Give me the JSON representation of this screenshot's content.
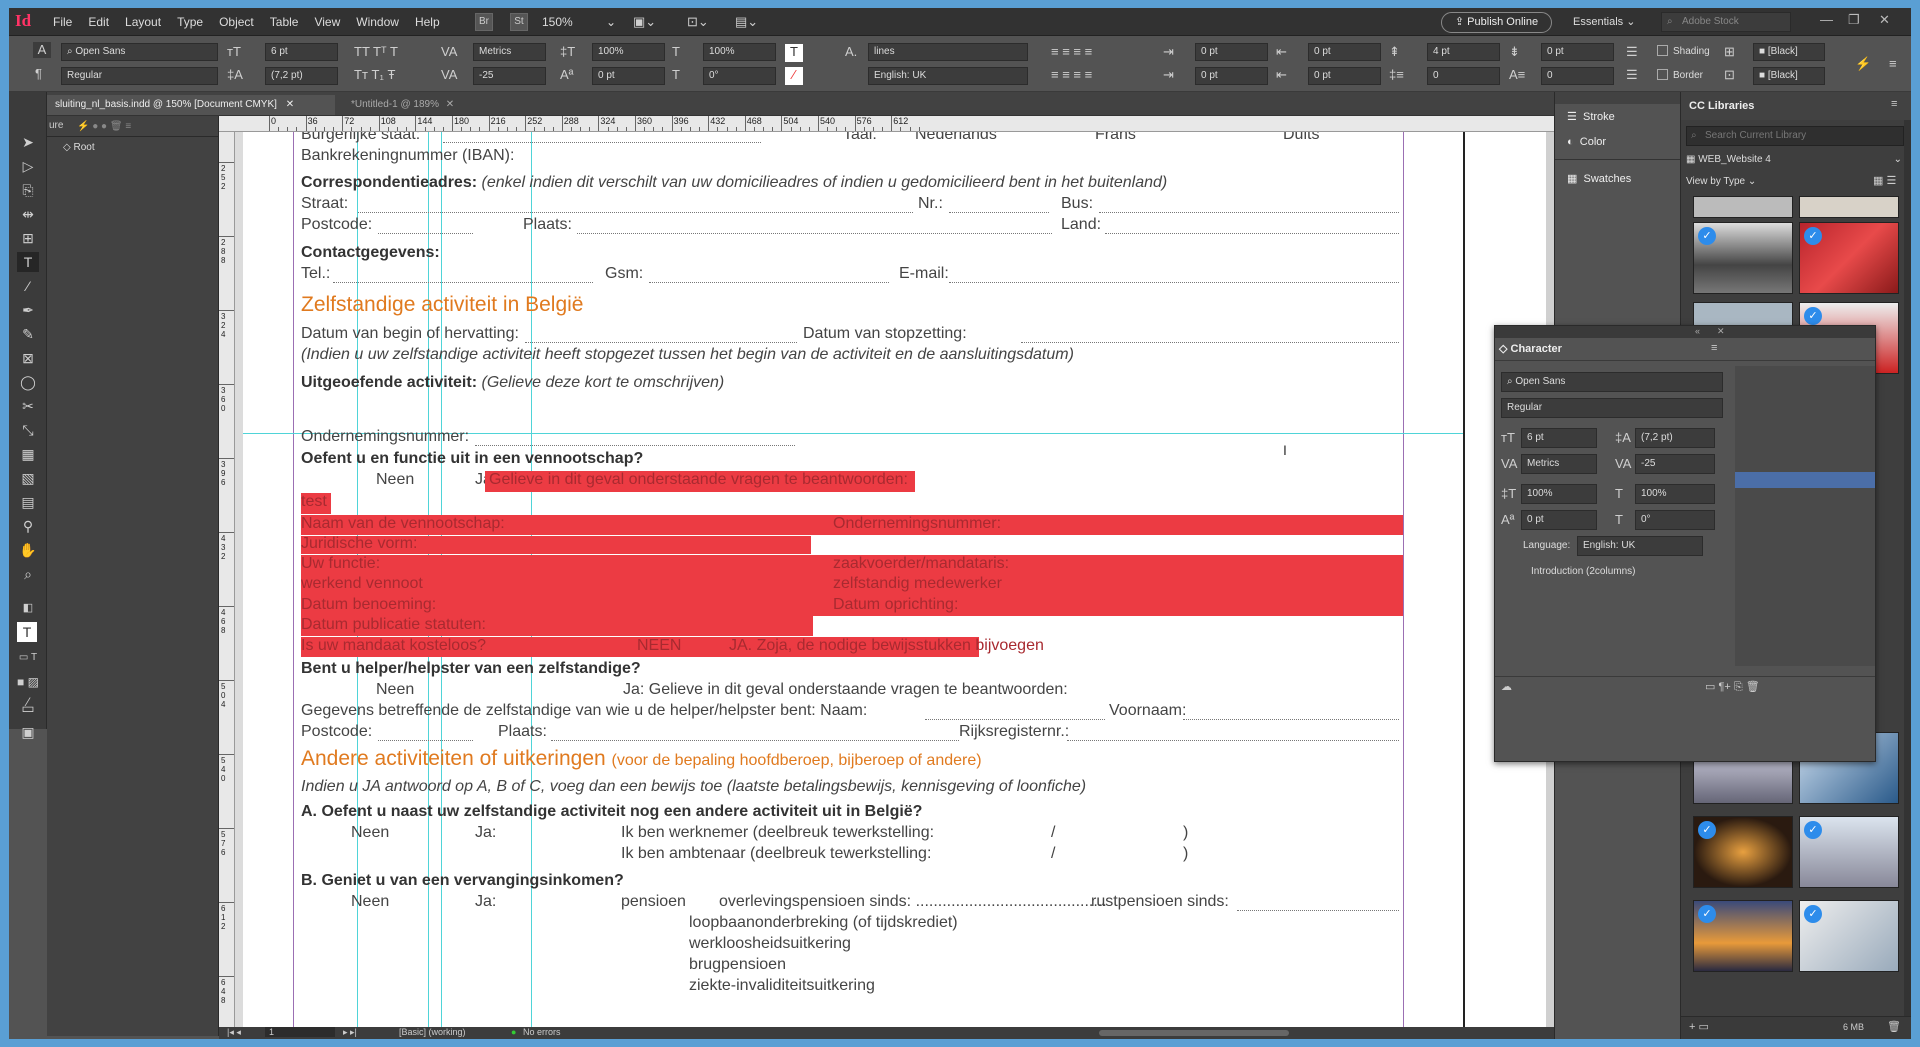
{
  "menubar": {
    "logo": "Id",
    "items": [
      "File",
      "Edit",
      "Layout",
      "Type",
      "Object",
      "Table",
      "View",
      "Window",
      "Help"
    ],
    "bridge": "Br",
    "stock_btn": "St",
    "zoom": "150%",
    "publish": "Publish Online",
    "workspace": "Essentials",
    "search_placeholder": "Adobe Stock"
  },
  "control": {
    "font_family": "Open Sans",
    "font_style": "Regular",
    "font_size": "6 pt",
    "leading": "(7,2 pt)",
    "kerning": "Metrics",
    "tracking": "-25",
    "vscale": "100%",
    "hscale": "100%",
    "baseline": "0 pt",
    "skew": "0°",
    "char_style": "lines",
    "language": "English: UK",
    "indent_left": "0 pt",
    "indent_first": "0 pt",
    "indent_right": "0 pt",
    "indent_last": "0 pt",
    "space_before": "4 pt",
    "space_after": "0 pt",
    "drop_lines": "0",
    "drop_chars": "0",
    "shading": "Shading",
    "border": "Border",
    "color1": "[Black]",
    "color2": "[Black]"
  },
  "tabs": [
    {
      "label": "sluiting_nl_basis.indd @ 150% [Document CMYK]"
    },
    {
      "label": "*Untitled-1 @ 189%"
    }
  ],
  "pages_panel": {
    "title": "ure",
    "root": "Root"
  },
  "hruler": [
    "0",
    "36",
    "72",
    "108",
    "144",
    "180",
    "216",
    "252",
    "288",
    "324",
    "360",
    "396",
    "432",
    "468",
    "504",
    "540",
    "576",
    "612"
  ],
  "vruler": [
    "2 5 2",
    "2 8 8",
    "3 2 4",
    "3 6 0",
    "3 9 6",
    "4 3 2",
    "4 6 8",
    "5 0 4",
    "5 4 0",
    "5 7 6",
    "6 1 2",
    "6 4 8"
  ],
  "doc": {
    "l1a": "Burgerlijke staat:",
    "l1b": "Taal:",
    "l1c": "Nederlands",
    "l1d": "Frans",
    "l1e": "Duits",
    "l2": "Bankrekeningnummer (IBAN):",
    "l3b": "Correspondentieadres:",
    "l3i": "(enkel indien dit verschilt van uw domicilieadres of indien u gedomicilieerd bent in het buitenland)",
    "l4a": "Straat:",
    "l4b": "Nr.:",
    "l4c": "Bus:",
    "l5a": "Postcode:",
    "l5b": "Plaats:",
    "l5c": "Land:",
    "l6": "Contactgegevens:",
    "l7a": "Tel.:",
    "l7b": "Gsm:",
    "l7c": "E-mail:",
    "h1": "Zelfstandige activiteit in België",
    "l8a": "Datum van begin of hervatting:",
    "l8b": "Datum van stopzetting:",
    "l9": "(Indien u uw zelfstandige activiteit heeft stopgezet tussen het begin van de activiteit en de aansluitingsdatum)",
    "l10b": "Uitgeoefende activiteit:",
    "l10i": "(Gelieve deze kort te omschrijven)",
    "l11": "Ondernemingsnummer:",
    "l12": "Oefent u en functie uit in een vennootschap?",
    "l13a": "Neen",
    "l13b": "Ja:",
    "l13c": "Gelieve in dit geval onderstaande vragen te beantwoorden:",
    "r1": "test",
    "r2a": "Naam van de vennootschap:",
    "r2b": "Ondernemingsnummer:",
    "r3": "Juridische vorm:",
    "r4a": "Uw functie:",
    "r4b": "zaakvoerder/mandataris:",
    "r5a": "werkend vennoot",
    "r5b": "zelfstandig medewerker",
    "r6a": "Datum benoeming:",
    "r6b": "Datum oprichting:",
    "r7": "Datum publicatie statuten:",
    "r8a": "Is uw mandaat kosteloos?",
    "r8b": "NEEN",
    "r8c": "JA. Zoja, de nodige bewijsstukken bijvoegen",
    "l14": "Bent u helper/helpster van een zelfstandige?",
    "l15a": "Neen",
    "l15b": "Ja: Gelieve in dit geval onderstaande vragen te beantwoorden:",
    "l16a": "Gegevens betreffende de zelfstandige van wie u de helper/helpster bent: Naam:",
    "l16b": "Voornaam:",
    "l17a": "Postcode:",
    "l17b": "Plaats:",
    "l17c": "Rijksregisternr.:",
    "h2": "Andere activiteiten of uitkeringen",
    "h2s": "(voor de bepaling hoofdberoep, bijberoep of andere)",
    "l18": "Indien u JA antwoord op A, B of C, voeg dan een bewijs toe (laatste betalingsbewijs, kennisgeving of loonfiche)",
    "l19": "A. Oefent u naast uw zelfstandige activiteit nog een andere activiteit uit in België?",
    "l20a": "Neen",
    "l20b": "Ja:",
    "l20c": "Ik ben werknemer (deelbreuk tewerkstelling:",
    "l20d": "/",
    "l20e": ")",
    "l21c": "Ik ben ambtenaar  (deelbreuk tewerkstelling:",
    "l21d": "/",
    "l21e": ")",
    "l22": "B. Geniet u van een vervangingsinkomen?",
    "l23a": "Neen",
    "l23b": "Ja:",
    "l23c": "pensioen",
    "l23d": "overlevingspensioen sinds: ...........................................",
    "l23e": "rustpensioen sinds:",
    "l24": "loopbaanonderbreking (of tijdskrediet)",
    "l25": "werkloosheidsuitkering",
    "l26": "brugpensioen",
    "l27": "ziekte-invaliditeitsuitkering"
  },
  "status": {
    "page": "1",
    "style": "[Basic] (working)",
    "errors": "No errors"
  },
  "panelA": {
    "stroke": "Stroke",
    "color": "Color",
    "swatches": "Swatches"
  },
  "libraries": {
    "title": "CC Libraries",
    "search": "Search Current Library",
    "library": "WEB_Website 4",
    "view": "View by Type",
    "size": "6 MB"
  },
  "character": {
    "title": "Character",
    "font": "Open Sans",
    "style": "Regular",
    "size": "6 pt",
    "leading": "(7,2 pt)",
    "kerning": "Metrics",
    "tracking": "-25",
    "vscale": "100%",
    "hscale": "100%",
    "baseline": "0 pt",
    "skew": "0°",
    "language_label": "Language:",
    "language": "English: UK",
    "style_item": "Introduction (2columns)"
  }
}
